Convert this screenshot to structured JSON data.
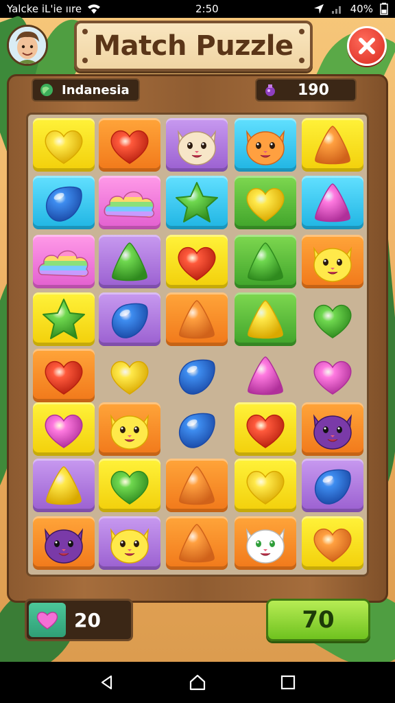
{
  "status_bar": {
    "carrier": "Yalcke iL'ie ııre",
    "time": "2:50",
    "battery": "40%"
  },
  "header": {
    "title": "Match Puzzle"
  },
  "hud": {
    "region": "Indanesia",
    "score": "190"
  },
  "footer": {
    "lives": "20",
    "moves": "70"
  },
  "colors": {
    "yellow": "#f7e21c",
    "orange": "#f7921e",
    "purple": "#b87ae0",
    "cyan": "#3fcdf0",
    "pink": "#f07ad8",
    "green": "#5cc43a"
  },
  "grid": [
    [
      {
        "bg": "yellow",
        "piece": "heart-yellow"
      },
      {
        "bg": "orange",
        "piece": "heart-red"
      },
      {
        "bg": "purple",
        "piece": "cat-cream"
      },
      {
        "bg": "cyan",
        "piece": "cat-orange"
      },
      {
        "bg": "yellow",
        "piece": "triangle-orange"
      }
    ],
    [
      {
        "bg": "cyan",
        "piece": "drop-blue"
      },
      {
        "bg": "pink",
        "piece": "cloud-rainbow"
      },
      {
        "bg": "cyan",
        "piece": "star-green"
      },
      {
        "bg": "green",
        "piece": "heart-yellow"
      },
      {
        "bg": "cyan",
        "piece": "triangle-pink"
      }
    ],
    [
      {
        "bg": "pink",
        "piece": "cloud-rainbow"
      },
      {
        "bg": "purple",
        "piece": "triangle-green"
      },
      {
        "bg": "yellow",
        "piece": "heart-red"
      },
      {
        "bg": "green",
        "piece": "triangle-green"
      },
      {
        "bg": "orange",
        "piece": "cat-yellow"
      }
    ],
    [
      {
        "bg": "yellow",
        "piece": "star-green"
      },
      {
        "bg": "purple",
        "piece": "drop-blue"
      },
      {
        "bg": "orange",
        "piece": "triangle-orange"
      },
      {
        "bg": "green",
        "piece": "triangle-yellow"
      },
      {
        "bg": "none",
        "piece": "heart-green"
      }
    ],
    [
      {
        "bg": "orange",
        "piece": "heart-red"
      },
      {
        "bg": "none",
        "piece": "heart-yellow"
      },
      {
        "bg": "none",
        "piece": "drop-blue"
      },
      {
        "bg": "none",
        "piece": "triangle-pink"
      },
      {
        "bg": "none",
        "piece": "heart-pink"
      }
    ],
    [
      {
        "bg": "yellow",
        "piece": "heart-pink"
      },
      {
        "bg": "orange",
        "piece": "cat-yellow"
      },
      {
        "bg": "none",
        "piece": "drop-blue"
      },
      {
        "bg": "yellow",
        "piece": "heart-red"
      },
      {
        "bg": "orange",
        "piece": "cat-purple"
      }
    ],
    [
      {
        "bg": "purple",
        "piece": "triangle-yellow"
      },
      {
        "bg": "yellow",
        "piece": "heart-green"
      },
      {
        "bg": "orange",
        "piece": "triangle-orange"
      },
      {
        "bg": "yellow",
        "piece": "heart-yellow"
      },
      {
        "bg": "purple",
        "piece": "drop-blue"
      }
    ],
    [
      {
        "bg": "orange",
        "piece": "cat-purple"
      },
      {
        "bg": "purple",
        "piece": "cat-yellow"
      },
      {
        "bg": "orange",
        "piece": "triangle-orange"
      },
      {
        "bg": "orange",
        "piece": "cat-white"
      },
      {
        "bg": "yellow",
        "piece": "heart-orange"
      }
    ]
  ],
  "icons": {
    "close": "close-icon",
    "globe": "globe-icon",
    "potion": "potion-icon",
    "lives": "heart-icon",
    "nav_back": "back-icon",
    "nav_home": "home-icon",
    "nav_recent": "recent-apps-icon"
  }
}
